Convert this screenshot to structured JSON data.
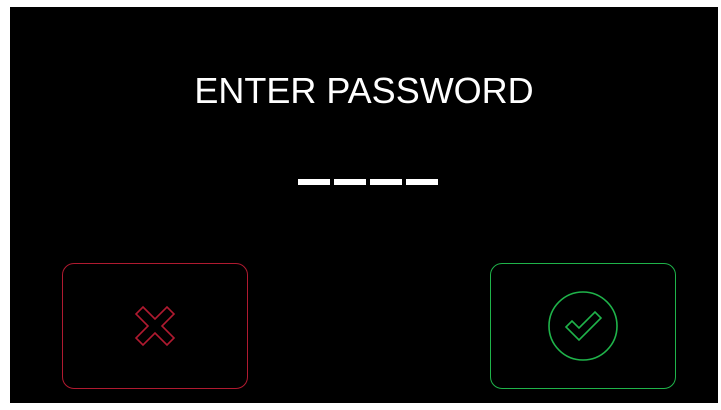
{
  "title": "ENTER PASSWORD",
  "pin": {
    "length": 4,
    "entered": 0
  },
  "buttons": {
    "cancel": {
      "icon": "close-icon",
      "color": "#b01a30"
    },
    "confirm": {
      "icon": "check-circle-icon",
      "color": "#1fb34a"
    }
  },
  "colors": {
    "background": "#000000",
    "text": "#ffffff"
  }
}
